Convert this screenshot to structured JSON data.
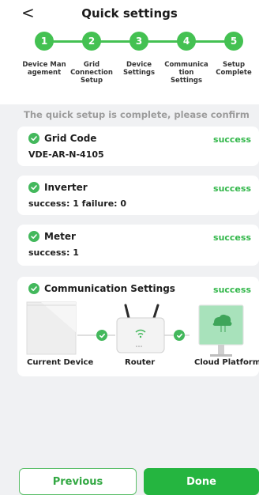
{
  "header": {
    "back_label": "<",
    "title": "Quick settings"
  },
  "steps": [
    {
      "number": "1",
      "label": "Device Man\nagement"
    },
    {
      "number": "2",
      "label": "Grid\nConnection\nSetup"
    },
    {
      "number": "3",
      "label": "Device\nSettings"
    },
    {
      "number": "4",
      "label": "Communica\ntion\nSettings"
    },
    {
      "number": "5",
      "label": "Setup\nComplete"
    }
  ],
  "confirm_text": "The quick setup is complete, please confirm",
  "cards": {
    "grid_code": {
      "title": "Grid Code",
      "status": "success",
      "detail": "VDE-AR-N-4105"
    },
    "inverter": {
      "title": "Inverter",
      "status": "success",
      "detail": "success: 1 failure: 0"
    },
    "meter": {
      "title": "Meter",
      "status": "success",
      "detail": "success: 1"
    },
    "communication": {
      "title": "Communication Settings",
      "status": "success",
      "labels": {
        "device": "Current Device",
        "router": "Router",
        "cloud": "Cloud Platform"
      }
    }
  },
  "buttons": {
    "previous": "Previous",
    "done": "Done"
  },
  "colors": {
    "accent": "#44c152",
    "success_text": "#32b74a",
    "done_button": "#25b540",
    "background": "#f0f1f3"
  }
}
